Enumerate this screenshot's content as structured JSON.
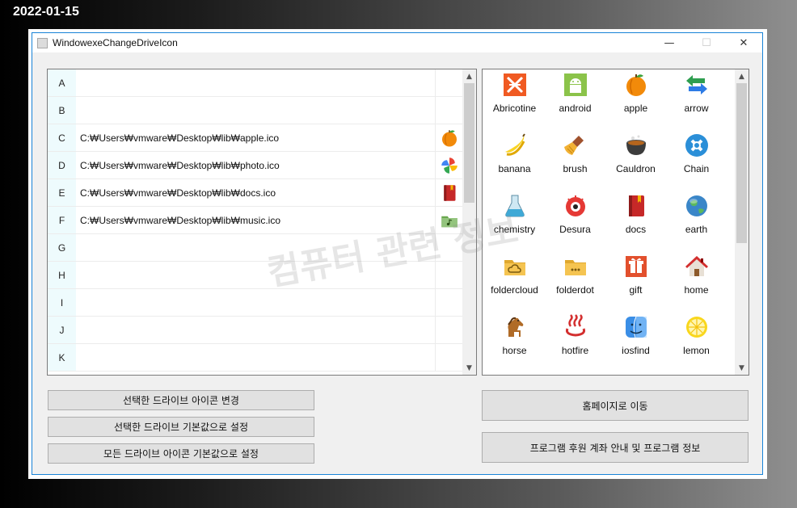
{
  "date_stamp": "2022-01-15",
  "window": {
    "title": "WindowexeChangeDriveIcon",
    "controls": {
      "minimize": "—",
      "maximize": "☐",
      "close": "✕"
    }
  },
  "drives": [
    {
      "letter": "A",
      "path": "",
      "icon": ""
    },
    {
      "letter": "B",
      "path": "",
      "icon": ""
    },
    {
      "letter": "C",
      "path": "C:₩Users₩vmware₩Desktop₩lib₩apple.ico",
      "icon": "apple"
    },
    {
      "letter": "D",
      "path": "C:₩Users₩vmware₩Desktop₩lib₩photo.ico",
      "icon": "photo"
    },
    {
      "letter": "E",
      "path": "C:₩Users₩vmware₩Desktop₩lib₩docs.ico",
      "icon": "docs"
    },
    {
      "letter": "F",
      "path": "C:₩Users₩vmware₩Desktop₩lib₩music.ico",
      "icon": "music"
    },
    {
      "letter": "G",
      "path": "",
      "icon": ""
    },
    {
      "letter": "H",
      "path": "",
      "icon": ""
    },
    {
      "letter": "I",
      "path": "",
      "icon": ""
    },
    {
      "letter": "J",
      "path": "",
      "icon": ""
    },
    {
      "letter": "K",
      "path": "",
      "icon": ""
    }
  ],
  "icon_library": [
    {
      "name": "Abricotine",
      "icon": "abricotine"
    },
    {
      "name": "android",
      "icon": "android"
    },
    {
      "name": "apple",
      "icon": "apple"
    },
    {
      "name": "arrow",
      "icon": "arrow"
    },
    {
      "name": "banana",
      "icon": "banana"
    },
    {
      "name": "brush",
      "icon": "brush"
    },
    {
      "name": "Cauldron",
      "icon": "cauldron"
    },
    {
      "name": "Chain",
      "icon": "chain"
    },
    {
      "name": "chemistry",
      "icon": "chemistry"
    },
    {
      "name": "Desura",
      "icon": "desura"
    },
    {
      "name": "docs",
      "icon": "docs"
    },
    {
      "name": "earth",
      "icon": "earth"
    },
    {
      "name": "foldercloud",
      "icon": "foldercloud"
    },
    {
      "name": "folderdot",
      "icon": "folderdot"
    },
    {
      "name": "gift",
      "icon": "gift"
    },
    {
      "name": "home",
      "icon": "home"
    },
    {
      "name": "horse",
      "icon": "horse"
    },
    {
      "name": "hotfire",
      "icon": "hotfire"
    },
    {
      "name": "iosfind",
      "icon": "iosfind"
    },
    {
      "name": "lemon",
      "icon": "lemon"
    }
  ],
  "watermark": "컴퓨터 관련 정보",
  "buttons": {
    "change_icon": "선택한 드라이브 아이콘 변경",
    "reset_selected": "선택한 드라이브 기본값으로 설정",
    "reset_all": "모든 드라이브 아이콘 기본값으로 설정",
    "homepage": "홈페이지로 이동",
    "donate_info": "프로그램 후원 계좌 안내 및 프로그램 정보"
  },
  "scrollbar_arrows": {
    "up": "▲",
    "down": "▼"
  },
  "colors": {
    "title_border": "#1883d7",
    "drive_letter_bg": "#eefbfd"
  }
}
